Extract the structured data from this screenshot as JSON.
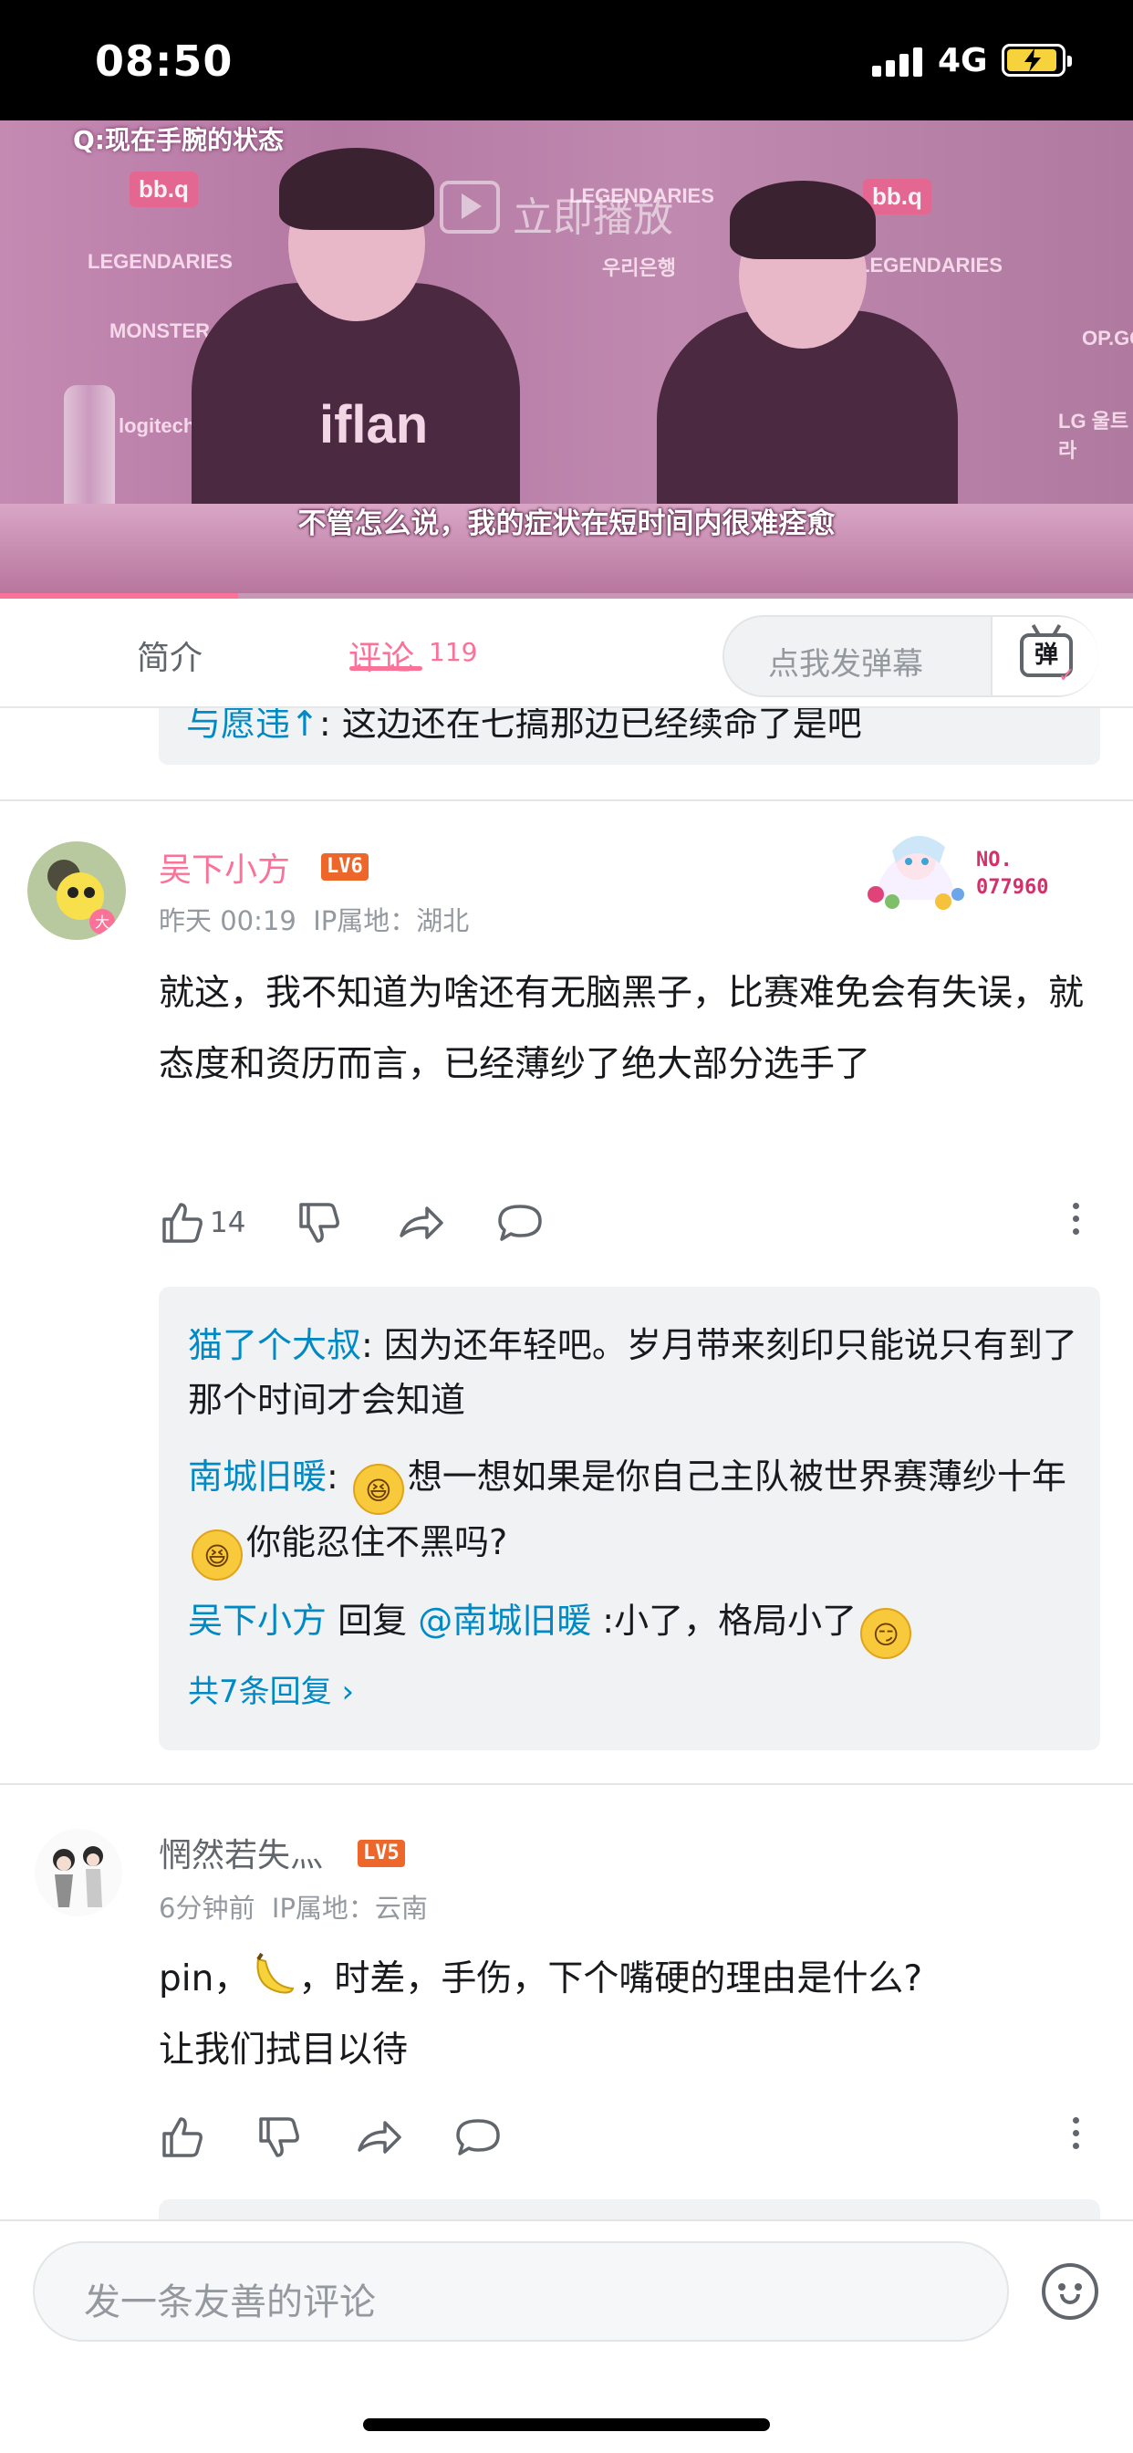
{
  "status_bar": {
    "time": "08:50",
    "network": "4G"
  },
  "video": {
    "question_caption": "Q:现在手腕的状态",
    "play_hint": "立即播放",
    "subtitle": "不管怎么说，我的症状在短时间内很难痊愈",
    "progress": 0.21,
    "sponsors": [
      "bb.q",
      "LEGENDARIES",
      "우리은행",
      "MONSTER",
      "logitech",
      "OP.GG",
      "LG 울트라",
      "iflan"
    ]
  },
  "tabs": {
    "intro": "简介",
    "comments": "评论",
    "comments_count": "119",
    "danmaku_placeholder": "点我发弹幕",
    "danmaku_icon_label": "弹"
  },
  "partial_reply": {
    "user": "与愿违↑",
    "text": ": 这边还在七搞那边已经续命了是吧"
  },
  "comments": [
    {
      "user": "吴下小方",
      "level": "LV6",
      "time": "昨天 00:19",
      "ip": "IP属地：湖北",
      "text": "就这，我不知道为啥还有无脑黑子，比赛难免会有失误，就态度和资历而言，已经薄纱了绝大部分选手了",
      "likes": "14",
      "fan_badge": {
        "label": "NO.",
        "number": "077960"
      },
      "replies": [
        {
          "user": "猫了个大叔",
          "text": ": 因为还年轻吧。岁月带来刻印只能说只有到了那个时间才会知道"
        },
        {
          "user": "南城旧暖",
          "sep": ": ",
          "text1": "想一想如果是你自己主队被世界赛薄纱十年",
          "text2": "你能忍住不黑吗?"
        },
        {
          "user": "吴下小方",
          "mid": " 回复 ",
          "mention": "@南城旧暖",
          "text": " :小了，格局小了"
        }
      ],
      "more_replies": "共7条回复"
    },
    {
      "user": "惘然若失灬",
      "level": "LV5",
      "time": "6分钟前",
      "ip": "IP属地：云南",
      "text1": "pin，",
      "text2": "，时差，手伤，下个嘴硬的理由是什么?",
      "text3": "让我们拭目以待"
    }
  ],
  "bottom": {
    "input_placeholder": "发一条友善的评论"
  },
  "colors": {
    "accent": "#fb7299",
    "link": "#008ac5",
    "lv6": "#ee672a",
    "lv5": "#ee672a"
  }
}
